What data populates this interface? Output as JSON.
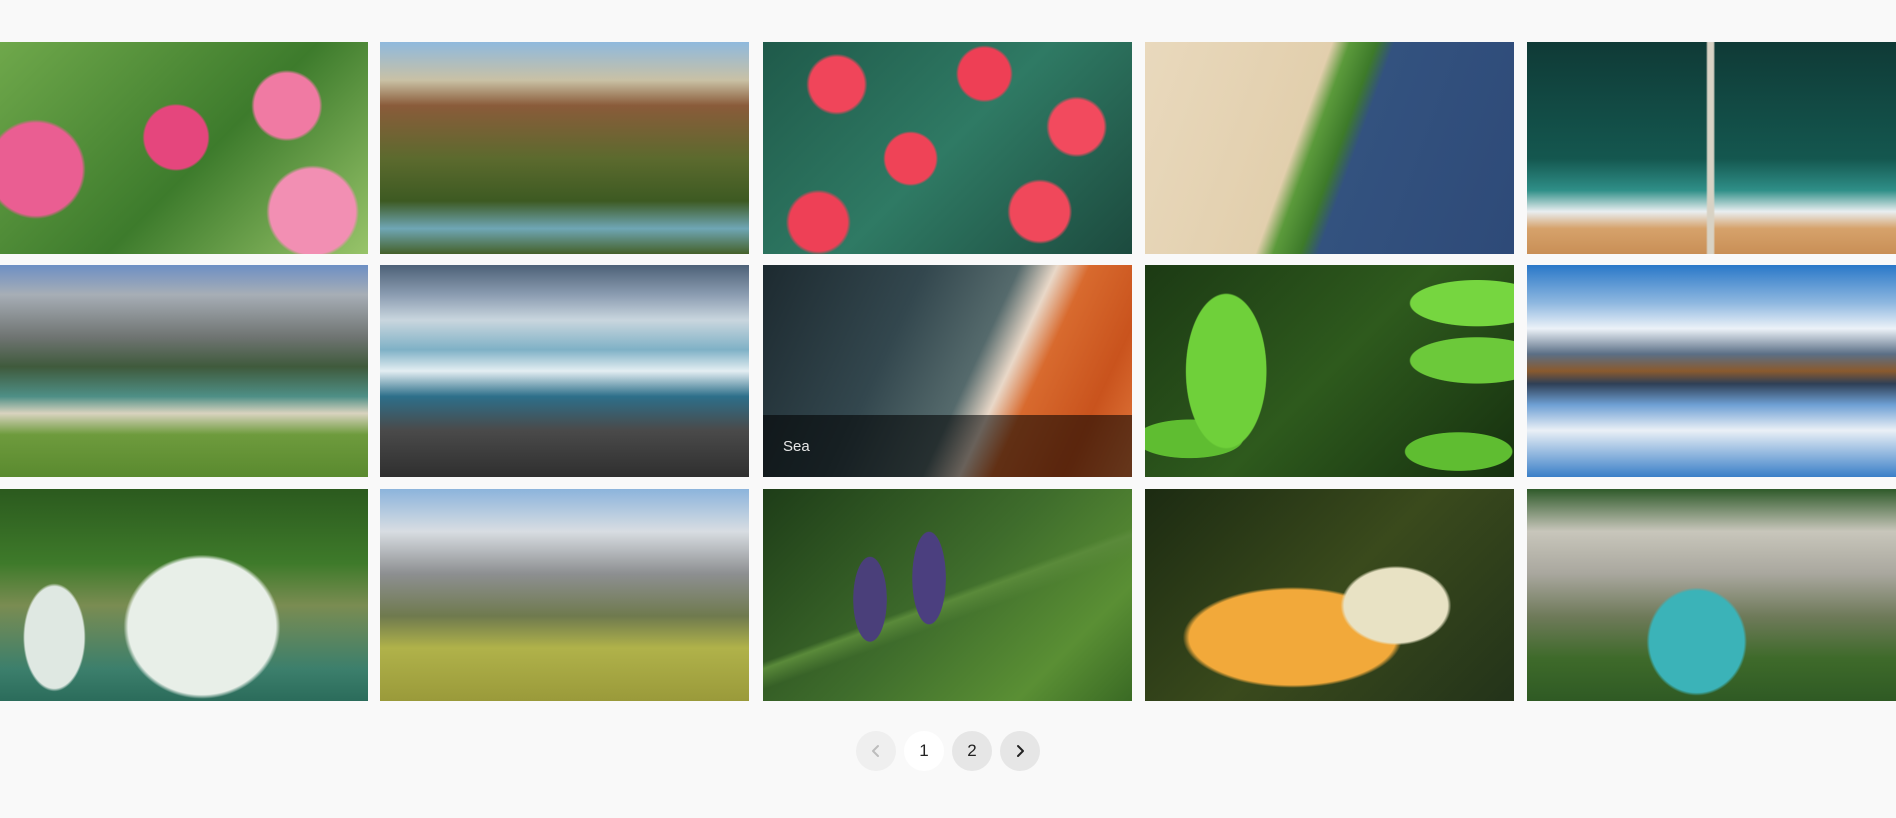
{
  "gallery": {
    "images": [
      {
        "icon": "pink-blossom-branch-image"
      },
      {
        "icon": "canyon-river-valley-image"
      },
      {
        "icon": "red-flowers-green-leaves-image"
      },
      {
        "icon": "aerial-shoreline-image"
      },
      {
        "icon": "aerial-beach-pier-image"
      },
      {
        "icon": "mountain-lake-meadow-image"
      },
      {
        "icon": "glacier-waterfall-image"
      },
      {
        "icon": "aerial-sea-coast-image",
        "caption": "Sea"
      },
      {
        "icon": "green-leaves-vine-image"
      },
      {
        "icon": "mountain-lake-reflection-image"
      },
      {
        "icon": "jungle-waterfall-image"
      },
      {
        "icon": "alpine-peaks-image"
      },
      {
        "icon": "fir-cones-branch-image"
      },
      {
        "icon": "butterfly-lily-image"
      },
      {
        "icon": "stone-bridge-gorge-image"
      }
    ]
  },
  "pagination": {
    "prev_icon": "chevron-left-icon",
    "pages": [
      "1",
      "2"
    ],
    "next_icon": "chevron-right-icon",
    "active_page": "1"
  }
}
